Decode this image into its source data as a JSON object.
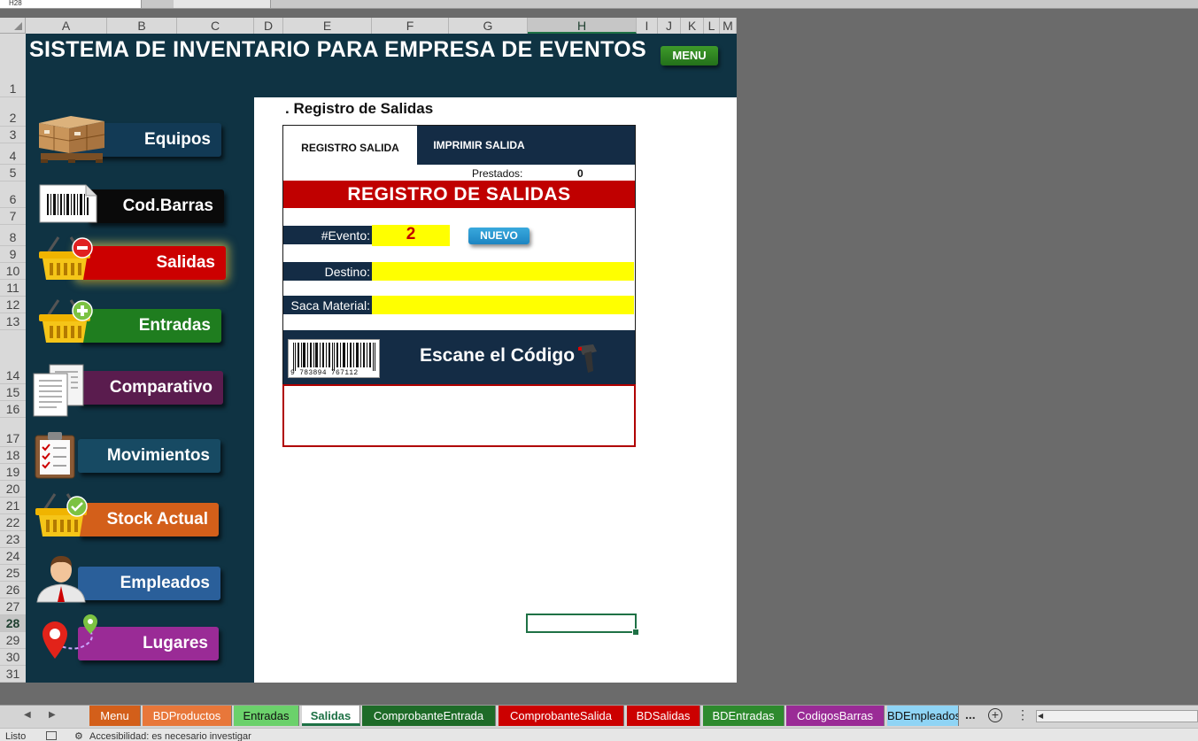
{
  "namebox": "H28",
  "columns": [
    "A",
    "B",
    "C",
    "D",
    "E",
    "F",
    "G",
    "H",
    "I",
    "J",
    "K",
    "L",
    "M"
  ],
  "rows": [
    "1",
    "2",
    "3",
    "4",
    "5",
    "6",
    "7",
    "8",
    "9",
    "10",
    "11",
    "12",
    "13",
    "14",
    "15",
    "16",
    "17",
    "18",
    "19",
    "20",
    "21",
    "22",
    "23",
    "24",
    "25",
    "26",
    "27",
    "28",
    "29",
    "30",
    "31"
  ],
  "selected_column": "H",
  "selected_row": "28",
  "title": "SISTEMA DE INVENTARIO PARA EMPRESA DE EVENTOS",
  "menu_label": "MENU",
  "nav": {
    "equipos": "Equipos",
    "codbarras": "Cod.Barras",
    "salidas": "Salidas",
    "entradas": "Entradas",
    "comparativo": "Comparativo",
    "movimientos": "Movimientos",
    "stock": "Stock Actual",
    "empleados": "Empleados",
    "lugares": "Lugares"
  },
  "form": {
    "heading": ". Registro de Salidas",
    "tab_registro": "REGISTRO SALIDA",
    "tab_imprimir": "IMPRIMIR SALIDA",
    "prestados_label": "Prestados:",
    "prestados_value": "0",
    "banner": "REGISTRO DE SALIDAS",
    "evento_label": "#Evento:",
    "evento_value": "2",
    "nuevo_label": "NUEVO",
    "destino_label": "Destino:",
    "destino_value": "",
    "saca_label": "Saca Material:",
    "saca_value": "",
    "barcode_digits": "9 783894 767112",
    "scan_label": "Escane el Código",
    "scan_value": ""
  },
  "sheets": {
    "menu": "Menu",
    "bdproductos": "BDProductos",
    "entradas": "Entradas",
    "salidas": "Salidas",
    "comprobante_entrada": "ComprobanteEntrada",
    "comprobante_salida": "ComprobanteSalida",
    "bdsalidas": "BDSalidas",
    "bdentradas": "BDEntradas",
    "codigos_barras": "CodigosBarras",
    "bdempleados": "BDEmpleados"
  },
  "sheets_more": "...",
  "status": {
    "ready": "Listo",
    "accessibility": "Accesibilidad: es necesario investigar"
  },
  "colors": {
    "dark_bg": "#0f3343",
    "form_header": "#142c45",
    "banner_red": "#c00000",
    "field_yellow": "#ffff00",
    "excel_green": "#1e7145"
  }
}
